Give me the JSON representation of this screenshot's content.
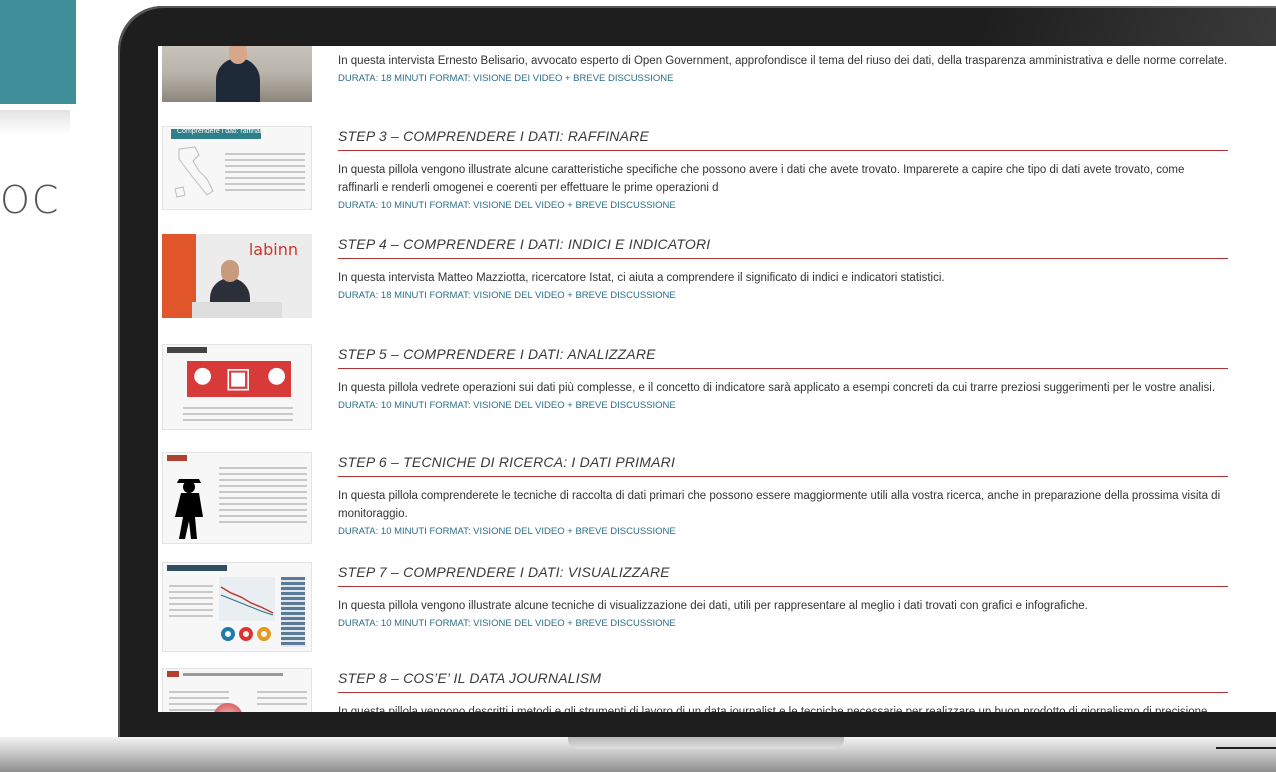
{
  "side": {
    "label": "OC"
  },
  "steps": [
    {
      "title": "",
      "desc": "In questa intervista Ernesto Belisario, avvocato esperto di Open Government, approfondisce il tema del riuso dei dati, della trasparenza amministrativa e delle norme correlate.",
      "meta": "DURATA: 18 MINUTI FORMAT: VISIONE DEI VIDEO + BREVE DISCUSSIONE"
    },
    {
      "title": "STEP 3 – COMPRENDERE I DATI: RAFFINARE",
      "desc": "In questa pillola vengono illustrate alcune caratteristiche specifiche che possono avere i dati che avete trovato. Imparerete a capire che tipo di dati avete trovato, come raffinarli e renderli omogenei e coerenti per effettuare le prime operazioni d",
      "meta": "DURATA: 10 MINUTI FORMAT: VISIONE DEL VIDEO + BREVE DISCUSSIONE"
    },
    {
      "title": "STEP 4 – COMPRENDERE I DATI: INDICI E INDICATORI",
      "desc": "In questa intervista Matteo Mazziotta, ricercatore Istat, ci aiuta a comprendere il significato di indici e indicatori statistici.",
      "meta": "DURATA: 18 MINUTI FORMAT: VISIONE DEL VIDEO + BREVE DISCUSSIONE"
    },
    {
      "title": "STEP 5 – COMPRENDERE I DATI: ANALIZZARE",
      "desc": "In questa pillola vedrete operazioni sui dati più complesse, e il concetto di indicatore sarà applicato a esempi concreti da cui trarre preziosi suggerimenti per le vostre analisi.",
      "meta": "DURATA: 10 MINUTI FORMAT: VISIONE DEL VIDEO + BREVE DISCUSSIONE"
    },
    {
      "title": "STEP 6 – TECNICHE DI RICERCA: I DATI PRIMARI",
      "desc": "In questa pillola comprenderete le tecniche di raccolta di dati primari che possono essere maggiormente utili alla vostra ricerca, anche in preparazione della prossima visita di monitoraggio.",
      "meta": "DURATA: 10 MINUTI FORMAT: VISIONE DEL VIDEO + BREVE DISCUSSIONE"
    },
    {
      "title": "STEP 7 – COMPRENDERE I DATI: VISUALIZZARE",
      "desc": "In questa pillola vengono illustrate alcune tecniche di visualizzazione dei dati, utili per rappresentare al meglio i dati trovati con grafici e infografiche.",
      "meta": "DURATA: 10 MINUTI FORMAT: VISIONE DEL VIDEO + BREVE DISCUSSIONE"
    },
    {
      "title": "STEP 8 – COS’E’ IL DATA JOURNALISM",
      "desc": "In questa pillola vengono descritti i metodi e gli strumenti di lavoro di un data journalist e le tecniche necessarie per realizzare un buon prodotto di giornalismo di precisione.",
      "meta": ""
    }
  ],
  "thumbs": {
    "step3_heading": "Comprendere i dati: raffinare",
    "labinn": "labinn"
  },
  "colors": {
    "teal": "#3f8f9a",
    "rule": "#b03232",
    "meta": "#2a6f86",
    "accent_red": "#d83a3a"
  }
}
